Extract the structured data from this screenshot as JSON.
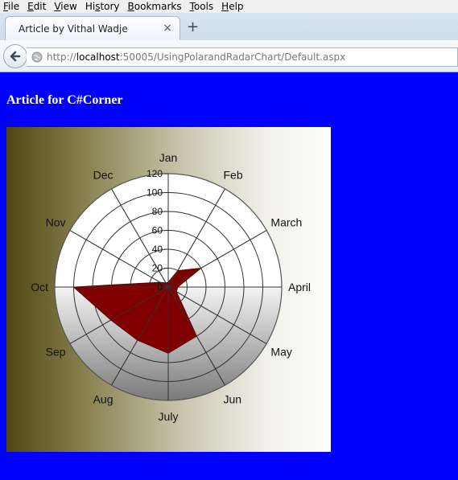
{
  "menu": [
    "File",
    "Edit",
    "View",
    "History",
    "Bookmarks",
    "Tools",
    "Help"
  ],
  "menu_access_keys": [
    "F",
    "E",
    "V",
    "s",
    "B",
    "T",
    "H"
  ],
  "tab": {
    "title": "Article by Vithal Wadje",
    "close_glyph": "×",
    "new_tab_glyph": "+"
  },
  "address": {
    "scheme": "http://",
    "host": "localhost",
    "rest": ":50005/UsingPolarandRadarChart/Default.aspx"
  },
  "page": {
    "title": "Article for C#Corner"
  },
  "colors": {
    "page_background": "#0000ff",
    "series_fill": "#800000"
  },
  "chart_data": {
    "type": "radar",
    "categories": [
      "Jan",
      "Feb",
      "March",
      "April",
      "May",
      "Jun",
      "July",
      "Aug",
      "Sep",
      "Oct",
      "Nov",
      "Dec"
    ],
    "series": [
      {
        "values": [
          5,
          20,
          40,
          10,
          10,
          60,
          70,
          65,
          70,
          100,
          10,
          5
        ]
      }
    ],
    "radial_ticks": [
      0,
      20,
      40,
      60,
      80,
      100,
      120
    ],
    "rlim": [
      0,
      120
    ],
    "grid": true,
    "background": "gradient olive to white"
  }
}
